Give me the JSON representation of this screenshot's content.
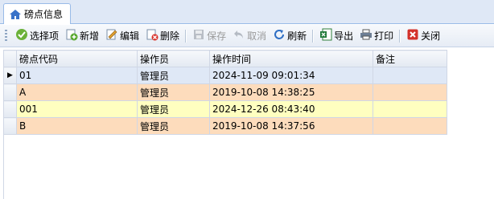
{
  "tab": {
    "label": "磅点信息"
  },
  "toolbar": {
    "select": "选择项",
    "add": "新增",
    "edit": "编辑",
    "delete": "删除",
    "save": "保存",
    "cancel": "取消",
    "refresh": "刷新",
    "export": "导出",
    "print": "打印",
    "close": "关闭"
  },
  "grid": {
    "columns": [
      "磅点代码",
      "操作员",
      "操作时间",
      "备注"
    ],
    "current_row_marker": "▶",
    "rows": [
      {
        "code": "01",
        "operator": "管理员",
        "time": "2024-11-09 09:01:34",
        "note": ""
      },
      {
        "code": "A",
        "operator": "管理员",
        "time": "2019-10-08 14:38:25",
        "note": ""
      },
      {
        "code": "001",
        "operator": "管理员",
        "time": "2024-12-26 08:43:40",
        "note": ""
      },
      {
        "code": "B",
        "operator": "管理员",
        "time": "2019-10-08 14:37:56",
        "note": ""
      }
    ]
  },
  "colors": {
    "selected": "#dfe8f6",
    "orange": "#fddcbc",
    "yellow": "#ffffc0"
  }
}
